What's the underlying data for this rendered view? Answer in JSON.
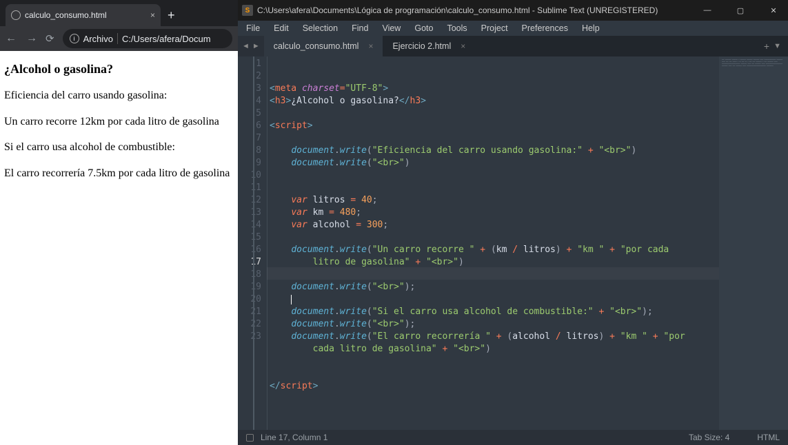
{
  "browser": {
    "tab_title": "calculo_consumo.html",
    "address_scheme": "Archivo",
    "address_path": "C:/Users/afera/Docum",
    "page": {
      "heading": "¿Alcohol o gasolina?",
      "line1": "Eficiencia del carro usando gasolina:",
      "line2": "Un carro recorre 12km por cada litro de gasolina",
      "line3": "Si el carro usa alcohol de combustible:",
      "line4": "El carro recorrería 7.5km por cada litro de gasolina"
    }
  },
  "sublime": {
    "window_title": "C:\\Users\\afera\\Documents\\Lógica de programación\\calculo_consumo.html - Sublime Text (UNREGISTERED)",
    "menu": [
      "File",
      "Edit",
      "Selection",
      "Find",
      "View",
      "Goto",
      "Tools",
      "Project",
      "Preferences",
      "Help"
    ],
    "tabs": {
      "active": "calculo_consumo.html",
      "inactive": "Ejercicio 2.html"
    },
    "status": {
      "position": "Line 17, Column 1",
      "tabsize": "Tab Size: 4",
      "syntax": "HTML"
    },
    "lines": [
      "1",
      "2",
      "3",
      "4",
      "5",
      "6",
      "7",
      "8",
      "9",
      "10",
      "11",
      "12",
      "13",
      "14",
      "15",
      "16",
      "17",
      "18",
      "19",
      "20",
      "21",
      "22",
      "23"
    ],
    "active_line": "17",
    "code": {
      "l1_tag": "meta",
      "l1_attr": "charset",
      "l1_val": "\"UTF-8\"",
      "l2_tag": "h3",
      "l2_text": "¿Alcohol o gasolina?",
      "l4_tag": "script",
      "doc": "document",
      "write": "write",
      "l6_str": "\"Eficiencia del carro usando gasolina:\"",
      "br_str": "\"<br>\"",
      "var_kw": "var",
      "litros_name": "litros",
      "litros_val": "40",
      "km_name": "km",
      "km_val": "480",
      "alcohol_name": "alcohol",
      "alcohol_val": "300",
      "l14_str1": "\"Un carro recorre \"",
      "l14_str2": "\"km \"",
      "l14_str3": "\"por cada litro de gasolina\"",
      "l18_str": "\"Si el carro usa alcohol de combustible:\"",
      "l20_str1": "\"El carro recorrería \"",
      "l20_str2": "\"km \"",
      "l20_str3": "\"por cada litro de gasolina\""
    }
  }
}
